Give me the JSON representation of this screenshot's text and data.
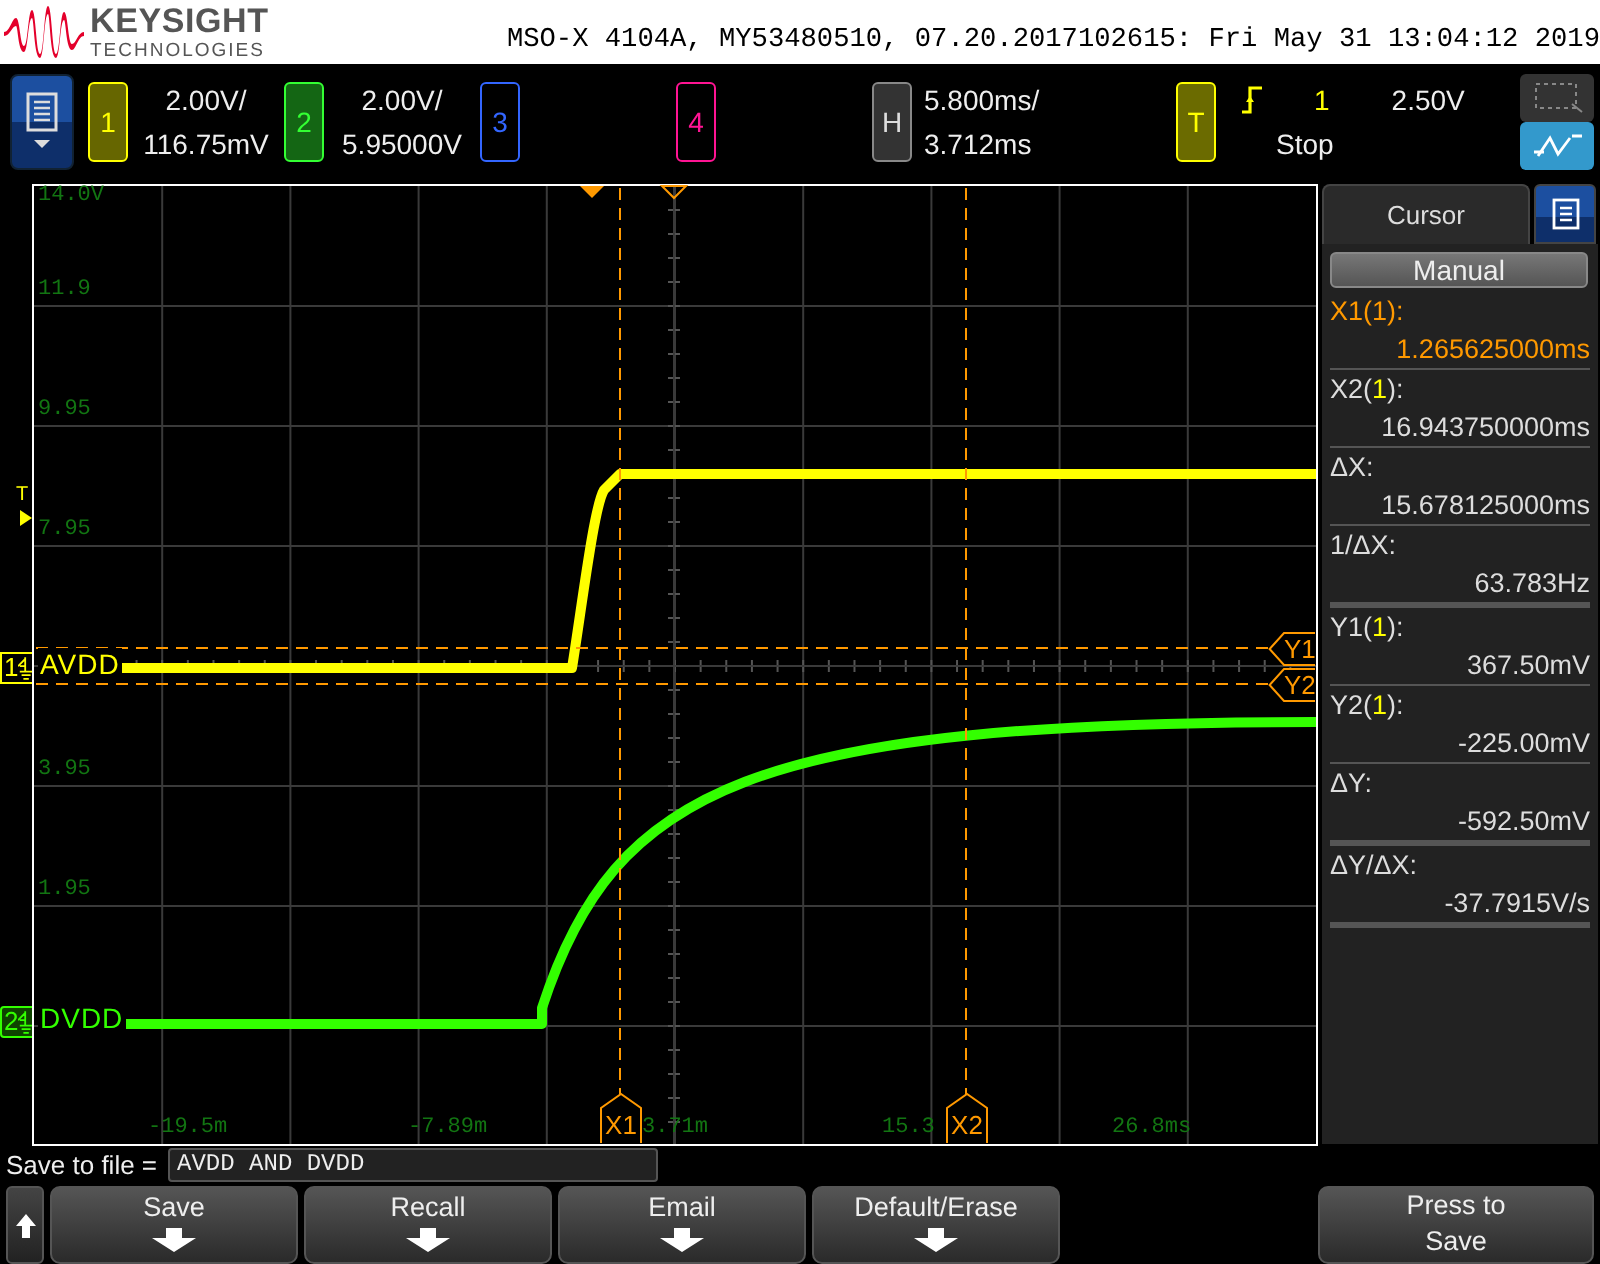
{
  "header": {
    "brand": "KEYSIGHT",
    "brand_sub": "TECHNOLOGIES",
    "title": "MSO-X 4104A, MY53480510, 07.20.2017102615: Fri May 31 13:04:12 2019"
  },
  "channels": [
    {
      "label": "1",
      "on": true,
      "color": "#ffff00",
      "scale": "2.00V/",
      "offset": "116.75mV"
    },
    {
      "label": "2",
      "on": true,
      "color": "#33ff33",
      "scale": "2.00V/",
      "offset": "5.95000V"
    },
    {
      "label": "3",
      "on": false,
      "color": "#3366ff"
    },
    {
      "label": "4",
      "on": false,
      "color": "#ff1493"
    }
  ],
  "horizontal": {
    "label": "H",
    "scale": "5.800ms/",
    "delay": "3.712ms"
  },
  "trigger": {
    "label": "T",
    "source": "1",
    "level": "2.50V",
    "status": "Stop"
  },
  "tools": [
    {
      "kind": "zoom",
      "selected": false
    },
    {
      "kind": "cursors",
      "selected": true
    }
  ],
  "graph": {
    "y_labels": [
      "14.0V",
      "11.9",
      "9.95",
      "7.95",
      "3.95",
      "1.95"
    ],
    "x_labels": [
      "-19.5m",
      "-7.89m",
      "3.71m",
      "15.3",
      "26.8ms"
    ],
    "trigger_marker": "T",
    "traces": [
      {
        "label": "AVDD",
        "marker": "1",
        "color": "#ffff00"
      },
      {
        "label": "DVDD",
        "marker": "2",
        "color": "#33ff00"
      }
    ],
    "x_cursors": [
      "X1",
      "X2"
    ],
    "y_cursors": [
      "Y1",
      "Y2"
    ]
  },
  "cursor_panel": {
    "tab": "Cursor",
    "mode": "Manual",
    "sections": [
      [
        {
          "label": "X1(",
          "source": "1",
          "suffix": "):",
          "value": "1.265625000ms",
          "active": true
        },
        {
          "label": "X2(",
          "source": "1",
          "suffix": "):",
          "value": "16.943750000ms",
          "active": false
        },
        {
          "label": "ΔX:",
          "value": "15.678125000ms",
          "active": false
        },
        {
          "label": "1/ΔX:",
          "value": "63.783Hz",
          "active": false
        }
      ],
      [
        {
          "label": "Y1(",
          "source": "1",
          "suffix": "):",
          "value": "367.50mV",
          "active": false
        },
        {
          "label": "Y2(",
          "source": "1",
          "suffix": "):",
          "value": "-225.00mV",
          "active": false
        },
        {
          "label": "ΔY:",
          "value": "-592.50mV",
          "active": false
        }
      ],
      [
        {
          "label": "ΔY/ΔX:",
          "value": "-37.7915V/s",
          "active": false
        }
      ]
    ]
  },
  "save_bar": {
    "label": "Save to file =",
    "value": "AVDD AND DVDD"
  },
  "softkeys": [
    {
      "label": "Save",
      "kind": "submenu"
    },
    {
      "label": "Recall",
      "kind": "submenu"
    },
    {
      "label": "Email",
      "kind": "submenu"
    },
    {
      "label": "Default/Erase",
      "kind": "submenu"
    },
    {
      "label": "Press to Save",
      "kind": "action"
    }
  ]
}
